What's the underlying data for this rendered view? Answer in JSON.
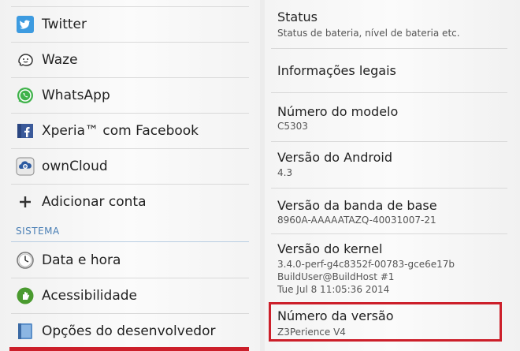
{
  "accounts": [
    {
      "label": "Twitter",
      "icon": "twitter-icon"
    },
    {
      "label": "Waze",
      "icon": "waze-icon"
    },
    {
      "label": "WhatsApp",
      "icon": "whatsapp-icon"
    },
    {
      "label": "Xperia™ com Facebook",
      "icon": "facebook-icon"
    },
    {
      "label": "ownCloud",
      "icon": "owncloud-icon"
    },
    {
      "label": "Adicionar conta",
      "icon": "add-icon"
    }
  ],
  "system_section": "SISTEMA",
  "system_items": [
    {
      "label": "Data e hora",
      "icon": "clock-icon"
    },
    {
      "label": "Acessibilidade",
      "icon": "accessibility-icon"
    },
    {
      "label": "Opções do desenvolvedor",
      "icon": "developer-icon"
    }
  ],
  "about": {
    "status_title": "Status",
    "status_sub": "Status de bateria, nível de bateria etc.",
    "legal_title": "Informações legais",
    "model_title": "Número do modelo",
    "model_value": "C5303",
    "android_title": "Versão do Android",
    "android_value": "4.3",
    "baseband_title": "Versão da banda de base",
    "baseband_value": "8960A-AAAAATAZQ-40031007-21",
    "kernel_title": "Versão do kernel",
    "kernel_line1": "3.4.0-perf-g4c8352f-00783-gce6e17b",
    "kernel_line2": "BuildUser@BuildHost #1",
    "kernel_line3": "Tue Jul 8 11:05:36 2014",
    "build_title": "Número da versão",
    "build_value": "Z3Perience V4"
  },
  "colors": {
    "highlight": "#cc1f2a",
    "section": "#4a7fb5"
  }
}
